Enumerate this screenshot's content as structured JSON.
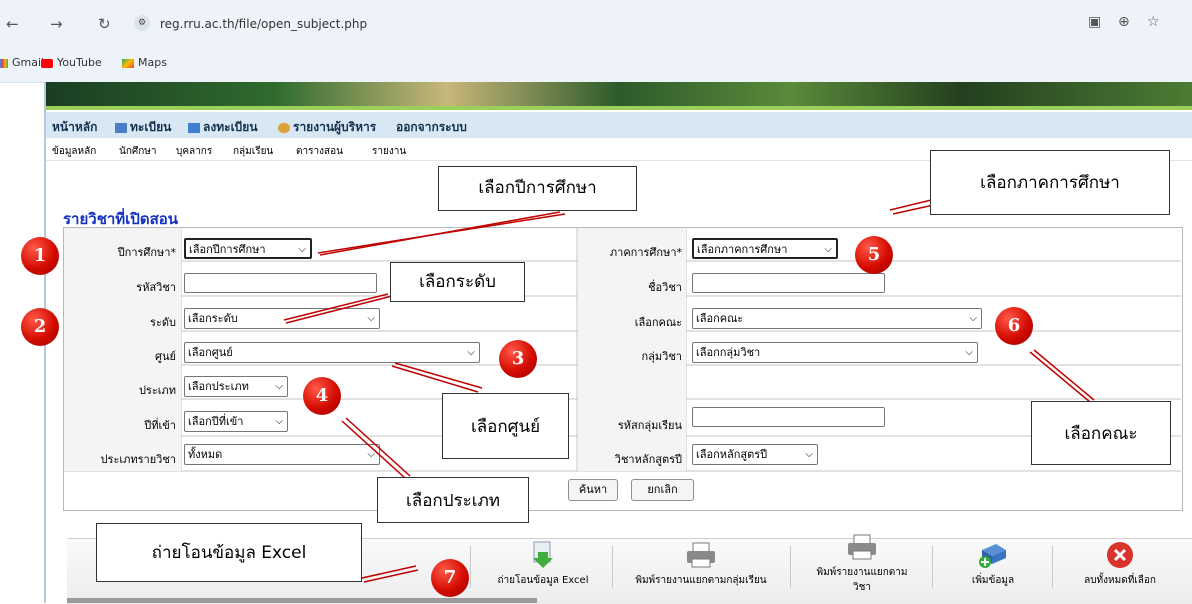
{
  "browser": {
    "url": "reg.rru.ac.th/file/open_subject.php",
    "bookmarks": [
      "Gmail",
      "YouTube",
      "Maps"
    ]
  },
  "menu": {
    "main": [
      "หน้าหลัก",
      "ทะเบียน",
      "ลงทะเบียน",
      "รายงานผู้บริหาร",
      "ออกจากระบบ"
    ],
    "sub": [
      "ข้อมูลหลัก",
      "นักศึกษา",
      "บุคลากร",
      "กลุ่มเรียน",
      "ตารางสอน",
      "รายงาน"
    ]
  },
  "page_title": "รายวิชาที่เปิดสอน",
  "form": {
    "year_label": "ปีการศึกษา*",
    "year_value": "เลือกปีการศึกษา",
    "semester_label": "ภาคการศึกษา*",
    "semester_value": "เลือกภาคการศึกษา",
    "code_label": "รหัสวิชา",
    "name_label": "ชื่อวิชา",
    "level_label": "ระดับ",
    "level_value": "เลือกระดับ",
    "faculty_label": "คณะ",
    "faculty_value": "เลือกคณะ",
    "center_label": "ศูนย์",
    "center_value": "เลือกศูนย์",
    "group_label": "กลุ่มวิชา",
    "group_value": "เลือกกลุ่มวิชา",
    "type_label": "ประเภท",
    "type_value": "เลือกประเภท",
    "entry_label": "ปีที่เข้า",
    "entry_value": "เลือกปีที่เข้า",
    "classgroup_label": "รหัสกลุ่มเรียน",
    "subjtype_label": "ประเภทรายวิชา",
    "subjtype_value": "ทั้งหมด",
    "curr_label": "วิชาหลักสูตรปี",
    "curr_value": "เลือกหลักสูตรปี",
    "search_btn": "ค้นหา",
    "cancel_btn": "ยกเลิก"
  },
  "toolbar": {
    "export": "ถ่ายโอนข้อมูล Excel",
    "print_group": "พิมพ์รายงานแยกตามกลุ่มเรียน",
    "print_subject_1": "พิมพ์รายงานแยกตาม",
    "print_subject_2": "วิชา",
    "add": "เพิ่มข้อมูล",
    "delete_all": "ลบทั้งหมดที่เลือก"
  },
  "callouts": {
    "year": "เลือกปีการศึกษา",
    "semester": "เลือกภาคการศึกษา",
    "level": "เลือกระดับ",
    "center": "เลือกศูนย์",
    "faculty": "เลือกคณะ",
    "type": "เลือกประเภท",
    "export": "ถ่ายโอนข้อมูล Excel"
  },
  "markers": [
    "1",
    "2",
    "3",
    "4",
    "5",
    "6",
    "7"
  ],
  "colors": {
    "marker_red": "#d40b00",
    "title_blue": "#1430c4",
    "menu_bg": "#d7e7f3"
  },
  "icons": [
    "back-icon",
    "forward-icon",
    "reload-icon",
    "site-info-icon",
    "translate-icon",
    "zoom-icon",
    "star-icon",
    "excel-export-icon",
    "printer-icon",
    "add-data-icon",
    "delete-icon"
  ]
}
